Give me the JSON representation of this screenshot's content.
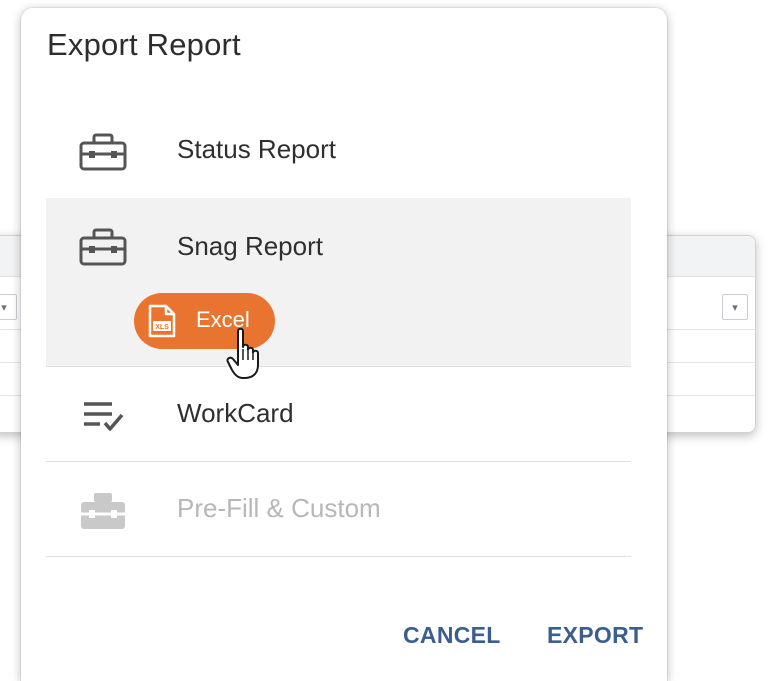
{
  "dialog": {
    "title": "Export Report",
    "items": [
      {
        "label": "Status Report",
        "icon": "toolbox-icon"
      },
      {
        "label": "Snag Report",
        "icon": "toolbox-icon",
        "selected": true
      },
      {
        "label": "WorkCard",
        "icon": "checklist-icon"
      },
      {
        "label": "Pre-Fill & Custom",
        "icon": "toolbox-icon",
        "disabled": true
      }
    ],
    "excel_option": {
      "label": "Excel",
      "icon_text": "XLS",
      "color": "#e8742f"
    },
    "actions": {
      "cancel": "CANCEL",
      "export": "EXPORT"
    }
  },
  "colors": {
    "accent": "#3a5f8d",
    "selected_bg": "#f2f2f2",
    "disabled_text": "#b7b7b7"
  }
}
